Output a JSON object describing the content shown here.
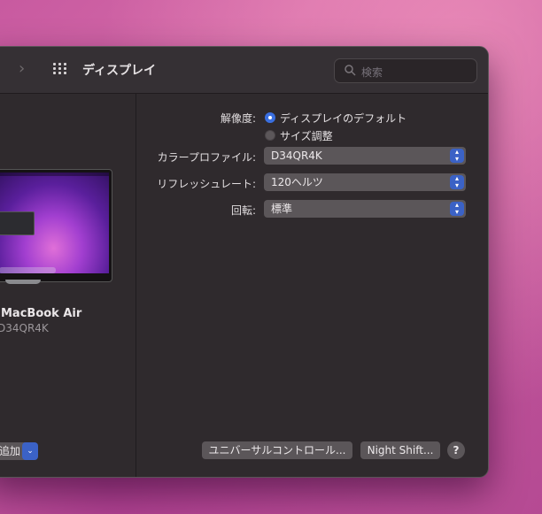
{
  "window": {
    "title": "ディスプレイ",
    "search_placeholder": "検索"
  },
  "sidebar": {
    "device_name": "MacBook Air",
    "device_subtitle": "D34QR4K",
    "add_label": "追加"
  },
  "settings": {
    "resolution_label": "解像度:",
    "resolution_options": [
      "ディスプレイのデフォルト",
      "サイズ調整"
    ],
    "resolution_selected": "ディスプレイのデフォルト",
    "color_profile_label": "カラープロファイル:",
    "color_profile_value": "D34QR4K",
    "refresh_label": "リフレッシュレート:",
    "refresh_value": "120ヘルツ",
    "rotation_label": "回転:",
    "rotation_value": "標準"
  },
  "buttons": {
    "universal_control": "ユニバーサルコントロール...",
    "night_shift": "Night Shift...",
    "help": "?"
  },
  "colors": {
    "accent": "#3a6fe0",
    "window_bg": "#2f2a2d"
  }
}
